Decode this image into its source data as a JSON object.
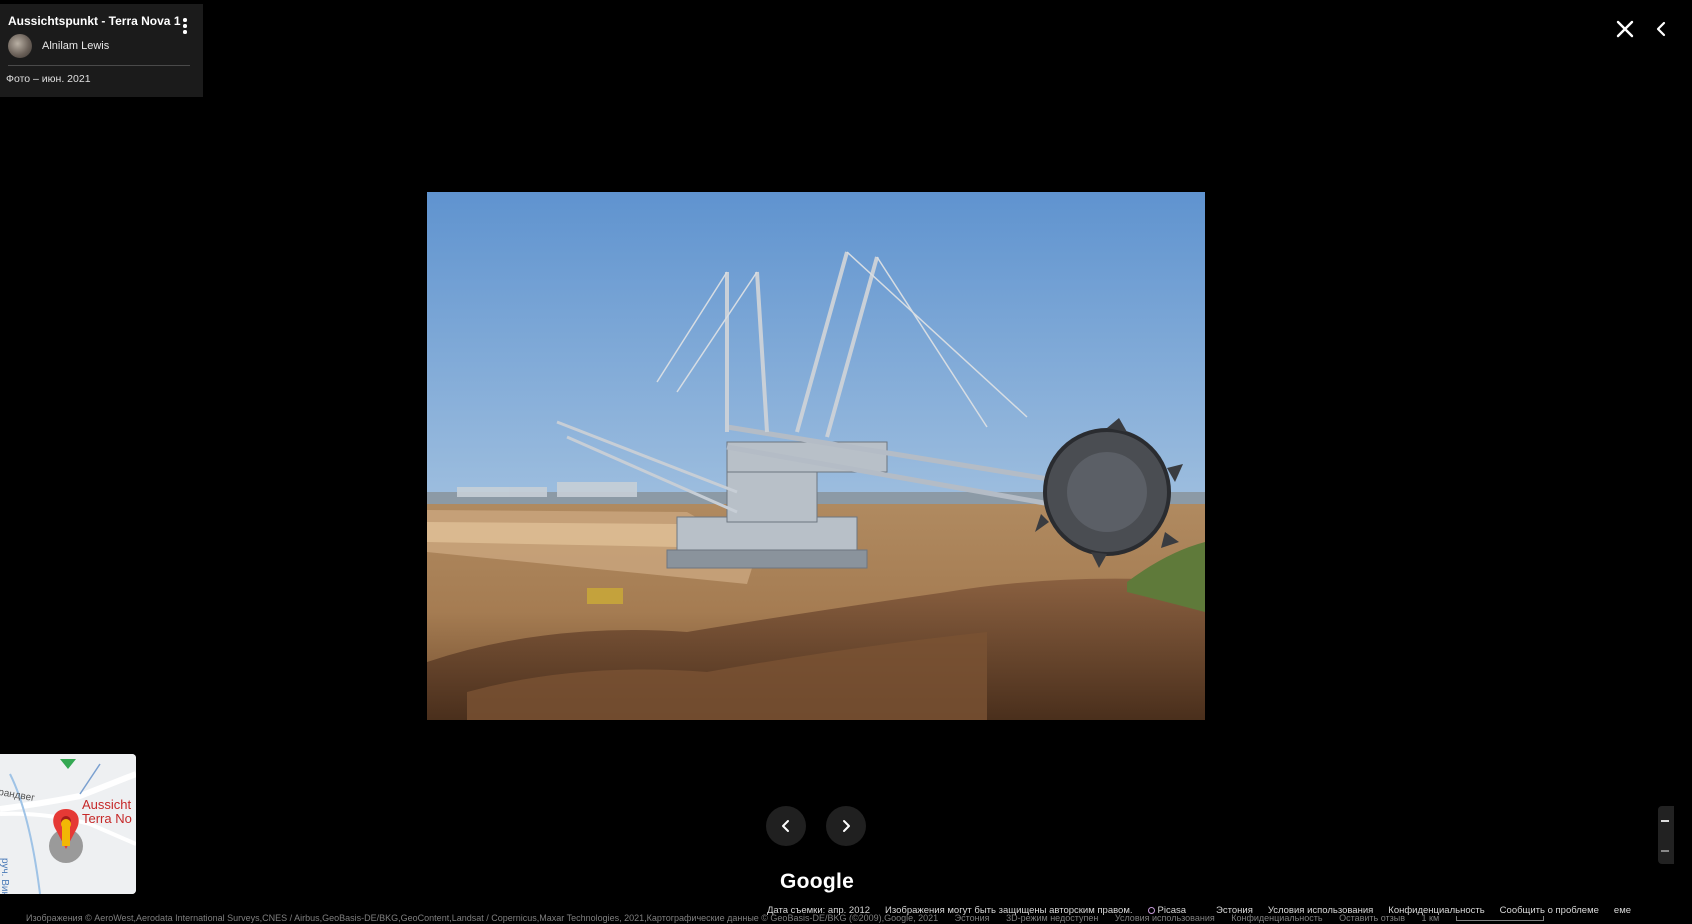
{
  "info_card": {
    "title": "Aussichtspunkt - Terra Nova 1",
    "author": "Alnilam Lewis",
    "photo_date": "Фото – июн. 2021"
  },
  "controls": {
    "close_icon": "close-icon",
    "collapse_icon": "chevron-left-icon",
    "menu_icon": "more-vert-icon",
    "prev_icon": "chevron-left-icon",
    "next_icon": "chevron-right-icon"
  },
  "photo": {
    "subject": "bucket-wheel excavator in open-pit mine"
  },
  "minimap": {
    "place_label_line1": "Aussicht",
    "place_label_line2": "Terra No",
    "street_label": "рандвег",
    "stream_label": "руч. Вин"
  },
  "branding": {
    "logo": "Google"
  },
  "credits": {
    "capture_date": "Дата съемки: апр. 2012",
    "copyright_note": "Изображения могут быть защищены авторским правом.",
    "picasa": "Picasa",
    "country": "Эстония",
    "terms": "Условия использования",
    "privacy": "Конфиденциальность",
    "report": "Сообщить о проблеме",
    "side_label": "еме"
  },
  "map_attribution": {
    "imagery": "Изображения © AeroWest,Aerodata International Surveys,CNES / Airbus,GeoBasis-DE/BKG,GeoContent,Landsat / Copernicus,Maxar Technologies, 2021,Картографические данные © GeoBasis-DE/BKG (©2009),Google, 2021",
    "country": "Эстония",
    "mode": "3D-режим недоступен",
    "terms": "Условия использования",
    "privacy": "Конфиденциальность",
    "feedback": "Оставить отзыв",
    "scale": "1 км"
  },
  "colors": {
    "background": "#000000",
    "card": "#1b1b1b",
    "pin": "#e53935"
  }
}
